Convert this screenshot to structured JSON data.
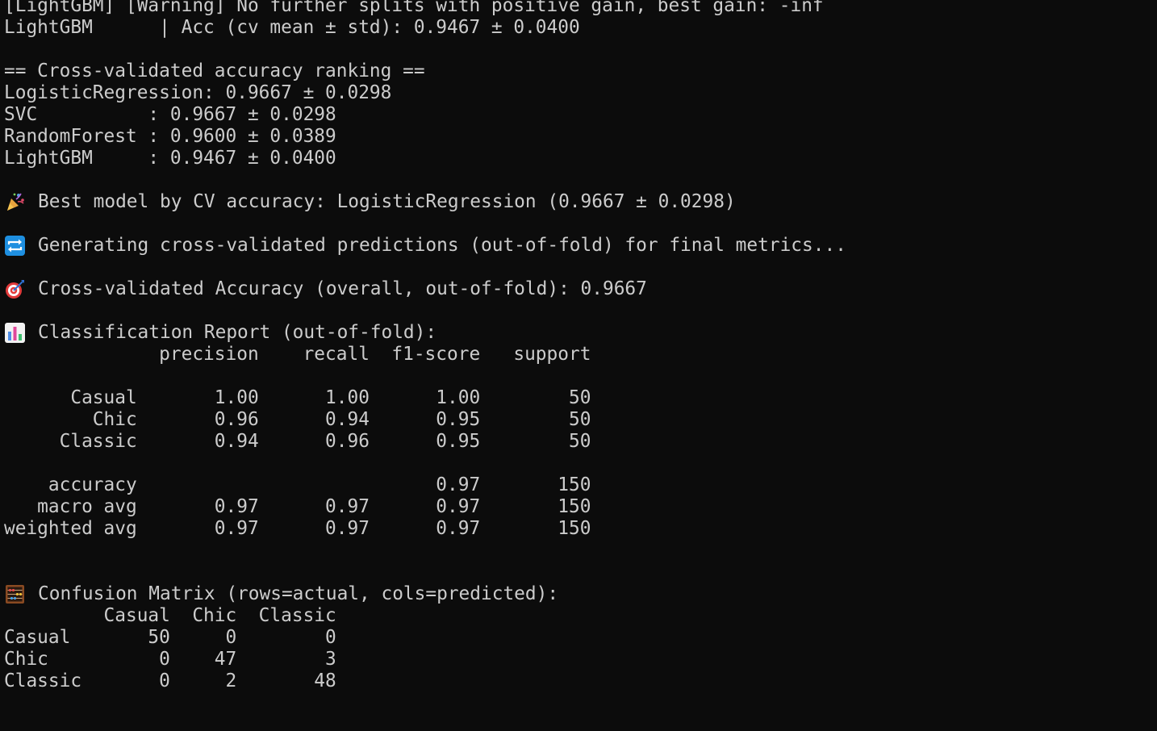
{
  "terminal": {
    "lines": [
      {
        "kind": "text",
        "text": "[LightGBM] [Warning] No further splits with positive gain, best gain: -inf"
      },
      {
        "kind": "text",
        "text": "LightGBM      | Acc (cv mean ± std): 0.9467 ± 0.0400"
      },
      {
        "kind": "blank"
      },
      {
        "kind": "text",
        "text": "== Cross-validated accuracy ranking =="
      },
      {
        "kind": "text",
        "text": "LogisticRegression: 0.9667 ± 0.0298"
      },
      {
        "kind": "text",
        "text": "SVC          : 0.9667 ± 0.0298"
      },
      {
        "kind": "text",
        "text": "RandomForest : 0.9600 ± 0.0389"
      },
      {
        "kind": "text",
        "text": "LightGBM     : 0.9467 ± 0.0400"
      },
      {
        "kind": "blank"
      },
      {
        "kind": "emoji",
        "icon": "party-popper-icon",
        "text": "Best model by CV accuracy: LogisticRegression (0.9667 ± 0.0298)"
      },
      {
        "kind": "blank"
      },
      {
        "kind": "emoji",
        "icon": "repeat-arrows-icon",
        "text": "Generating cross-validated predictions (out-of-fold) for final metrics..."
      },
      {
        "kind": "blank"
      },
      {
        "kind": "emoji",
        "icon": "target-icon",
        "text": "Cross-validated Accuracy (overall, out-of-fold): 0.9667"
      },
      {
        "kind": "blank"
      },
      {
        "kind": "emoji",
        "icon": "bar-chart-icon",
        "text": "Classification Report (out-of-fold):"
      },
      {
        "kind": "text",
        "text": "              precision    recall  f1-score   support"
      },
      {
        "kind": "blank"
      },
      {
        "kind": "text",
        "text": "      Casual       1.00      1.00      1.00        50"
      },
      {
        "kind": "text",
        "text": "        Chic       0.96      0.94      0.95        50"
      },
      {
        "kind": "text",
        "text": "     Classic       0.94      0.96      0.95        50"
      },
      {
        "kind": "blank"
      },
      {
        "kind": "text",
        "text": "    accuracy                           0.97       150"
      },
      {
        "kind": "text",
        "text": "   macro avg       0.97      0.97      0.97       150"
      },
      {
        "kind": "text",
        "text": "weighted avg       0.97      0.97      0.97       150"
      },
      {
        "kind": "blank"
      },
      {
        "kind": "blank"
      },
      {
        "kind": "emoji",
        "icon": "abacus-icon",
        "text": "Confusion Matrix (rows=actual, cols=predicted):"
      },
      {
        "kind": "text",
        "text": "         Casual  Chic  Classic"
      },
      {
        "kind": "text",
        "text": "Casual       50     0        0"
      },
      {
        "kind": "text",
        "text": "Chic          0    47        3"
      },
      {
        "kind": "text",
        "text": "Classic       0     2       48"
      }
    ]
  },
  "colors": {
    "background": "#0c0c0c",
    "foreground": "#cccccc"
  }
}
